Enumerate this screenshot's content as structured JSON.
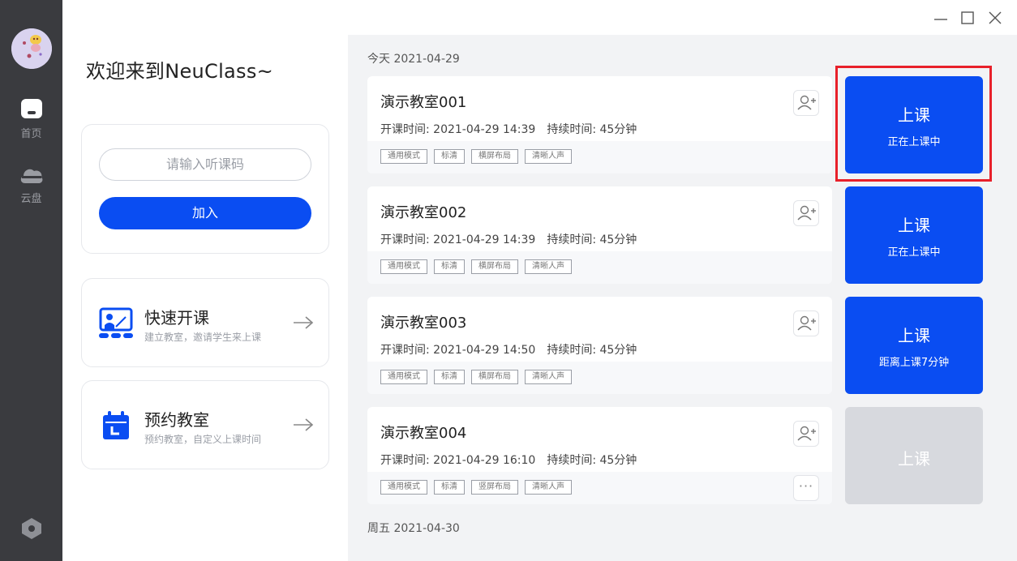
{
  "sidebar": {
    "items": [
      {
        "label": "首页",
        "icon": "home-icon"
      },
      {
        "label": "云盘",
        "icon": "cloud-icon"
      }
    ],
    "settings_icon": "settings-icon"
  },
  "left": {
    "welcome": "欢迎来到NeuClass~",
    "join": {
      "placeholder": "请输入听课码",
      "button": "加入"
    },
    "actions": [
      {
        "title": "快速开课",
        "subtitle": "建立教室，邀请学生来上课",
        "icon": "classroom-teacher-icon"
      },
      {
        "title": "预约教室",
        "subtitle": "预约教室，自定义上课时间",
        "icon": "calendar-icon"
      }
    ]
  },
  "schedule": {
    "today_heading": "今天 2021-04-29",
    "next_heading": "周五 2021-04-30",
    "rooms": [
      {
        "name": "演示教室001",
        "start": "开课时间: 2021-04-29 14:39",
        "duration": "持续时间: 45分钟",
        "tags": [
          "通用模式",
          "标清",
          "横屏布局",
          "清晰人声"
        ],
        "button": "上课",
        "status": "正在上课中"
      },
      {
        "name": "演示教室002",
        "start": "开课时间: 2021-04-29 14:39",
        "duration": "持续时间: 45分钟",
        "tags": [
          "通用模式",
          "标清",
          "横屏布局",
          "清晰人声"
        ],
        "button": "上课",
        "status": "正在上课中"
      },
      {
        "name": "演示教室003",
        "start": "开课时间: 2021-04-29 14:50",
        "duration": "持续时间: 45分钟",
        "tags": [
          "通用模式",
          "标清",
          "横屏布局",
          "清晰人声"
        ],
        "button": "上课",
        "status": "距离上课7分钟"
      },
      {
        "name": "演示教室004",
        "start": "开课时间: 2021-04-29 16:10",
        "duration": "持续时间: 45分钟",
        "tags": [
          "通用模式",
          "标清",
          "竖屏布局",
          "清晰人声"
        ],
        "button": "上课",
        "status": ""
      }
    ],
    "more_label": "···"
  },
  "colors": {
    "accent": "#0a4df2",
    "sidebar": "#3a3b3f",
    "panel": "#f2f3f5",
    "disabled": "#d7d9de",
    "highlight": "#e8202a"
  }
}
